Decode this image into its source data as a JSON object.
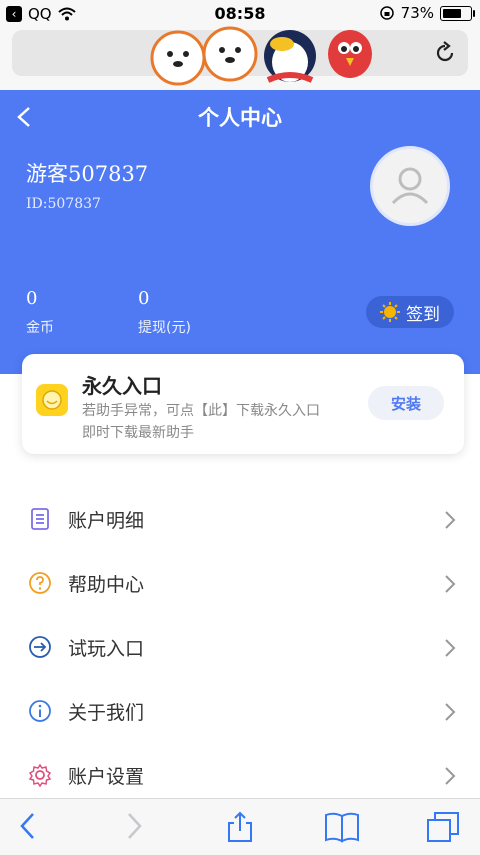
{
  "status": {
    "carrier": "QQ",
    "time": "08:58",
    "battery_percent": "73%",
    "battery_level": 0.73
  },
  "header": {
    "title": "个人中心",
    "username": "游客507837",
    "user_id": "ID:507837",
    "stats": [
      {
        "value": "0",
        "label": "金币"
      },
      {
        "value": "0",
        "label": "提现(元)"
      }
    ],
    "checkin_label": "签到"
  },
  "card": {
    "title": "永久入口",
    "desc_line1": "若助手异常，可点【此】下载永久入口",
    "desc_line2": "即时下载最新助手",
    "button": "安装"
  },
  "menu": [
    {
      "label": "账户明细",
      "icon": "list-doc-icon"
    },
    {
      "label": "帮助中心",
      "icon": "help-circle-icon"
    },
    {
      "label": "试玩入口",
      "icon": "enter-arrow-icon"
    },
    {
      "label": "关于我们",
      "icon": "info-circle-icon"
    },
    {
      "label": "账户设置",
      "icon": "settings-gear-icon"
    }
  ],
  "colors": {
    "primary": "#4f7af4",
    "yellow": "#ffd21f"
  }
}
